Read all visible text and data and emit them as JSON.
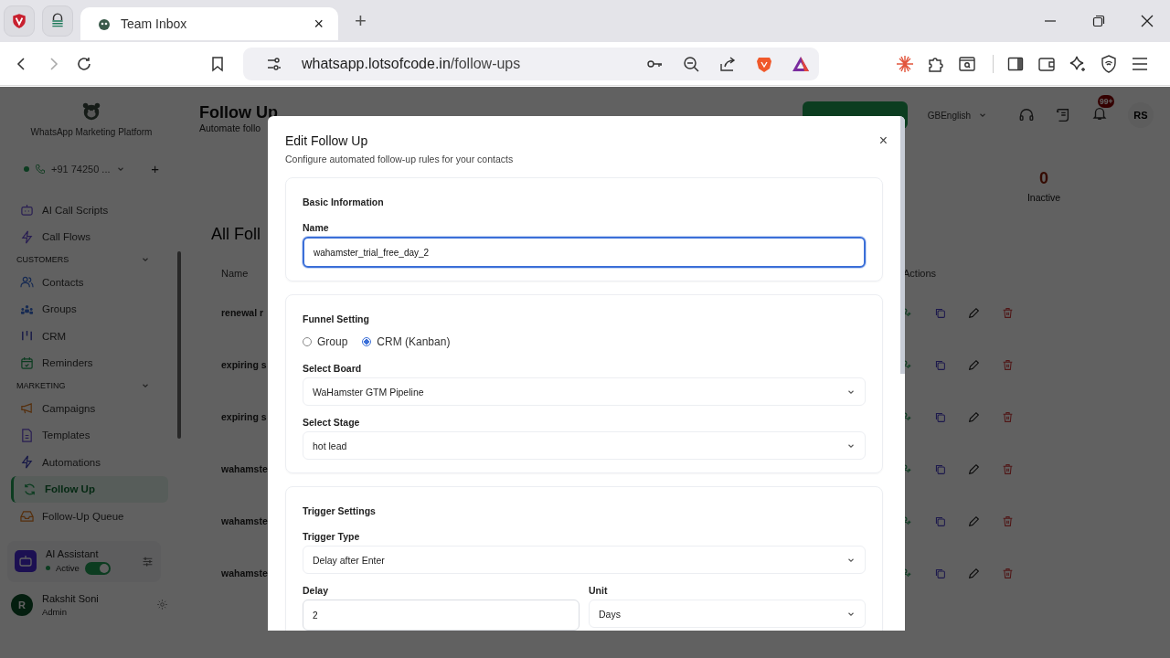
{
  "browser": {
    "tabs": [
      {
        "title": "Team Inbox",
        "selected": true,
        "close": "×"
      }
    ],
    "new_tab": "+",
    "url": {
      "host": "whatsapp.lotsofcode.in",
      "path": "/follow-ups"
    }
  },
  "sidebar": {
    "brand": "WhatsApp Marketing Platform",
    "phone": {
      "number": "+91 74250 ...",
      "online": true,
      "add": "+"
    },
    "groups": [
      {
        "items": [
          {
            "label": "AI Call Scripts",
            "selected": false
          },
          {
            "label": "Call Flows",
            "selected": false
          }
        ]
      },
      {
        "heading": "CUSTOMERS",
        "expanded": true,
        "items": [
          {
            "label": "Contacts",
            "selected": false
          },
          {
            "label": "Groups",
            "selected": false
          },
          {
            "label": "CRM",
            "selected": false
          },
          {
            "label": "Reminders",
            "selected": false
          }
        ]
      },
      {
        "heading": "MARKETING",
        "expanded": true,
        "items": [
          {
            "label": "Campaigns",
            "selected": false
          },
          {
            "label": "Templates",
            "selected": false
          },
          {
            "label": "Automations",
            "selected": false
          },
          {
            "label": "Follow Up",
            "selected": true
          },
          {
            "label": "Follow-Up Queue",
            "selected": false
          }
        ]
      }
    ],
    "assistant": {
      "title": "AI Assistant",
      "status": "Active",
      "on": true
    },
    "user": {
      "initial": "R",
      "name": "Rakshit Soni",
      "role": "Admin"
    }
  },
  "header": {
    "title": "Follow Up",
    "subtitle": "Automate follo",
    "language": "GBEnglish",
    "notifications": "99+",
    "avatar": "RS"
  },
  "stats": [
    {
      "value": "0",
      "label": "Inactive"
    }
  ],
  "table": {
    "title": "All Foll",
    "columns": [
      "Name",
      "Actions"
    ],
    "rows": [
      {
        "name": "renewal r"
      },
      {
        "name": "expiring s"
      },
      {
        "name": "expiring s"
      },
      {
        "name": "wahamste"
      },
      {
        "name": "wahamste"
      },
      {
        "name": "wahamste"
      }
    ]
  },
  "modal": {
    "title": "Edit Follow Up",
    "subtitle": "Configure automated follow-up rules for your contacts",
    "close": "×",
    "sections": [
      {
        "heading": "Basic Information",
        "fields": [
          {
            "kind": "text",
            "label": "Name",
            "value": "wahamster_trial_free_day_2",
            "focused": true
          }
        ]
      },
      {
        "heading": "Funnel Setting",
        "fields": [
          {
            "kind": "radio",
            "options": [
              {
                "label": "Group",
                "selected": false
              },
              {
                "label": "CRM (Kanban)",
                "selected": true
              }
            ]
          },
          {
            "kind": "select",
            "label": "Select Board",
            "value": "WaHamster GTM Pipeline"
          },
          {
            "kind": "select",
            "label": "Select Stage",
            "value": "hot lead"
          }
        ]
      },
      {
        "heading": "Trigger Settings",
        "fields": [
          {
            "kind": "select",
            "label": "Trigger Type",
            "value": "Delay after Enter"
          },
          {
            "kind": "pair",
            "fields": [
              {
                "kind": "text",
                "label": "Delay",
                "value": "2",
                "focused": false
              },
              {
                "kind": "select",
                "label": "Unit",
                "value": "Days"
              }
            ]
          }
        ]
      }
    ]
  }
}
